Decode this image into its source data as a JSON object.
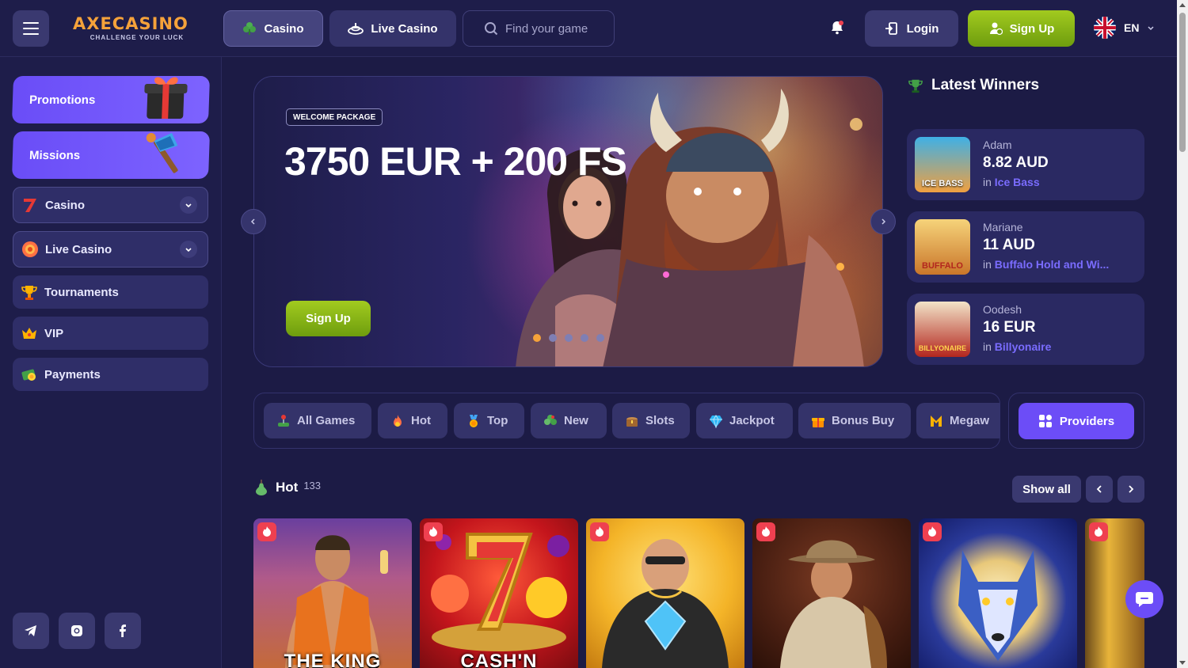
{
  "header": {
    "logo_text": "AXECASINO",
    "logo_tagline": "CHALLENGE YOUR LUCK",
    "nav_casino": "Casino",
    "nav_live_casino": "Live Casino",
    "search_placeholder": "Find your game",
    "login_label": "Login",
    "signup_label": "Sign Up",
    "language": "EN"
  },
  "sidebar": {
    "promo_cards": [
      "Promotions",
      "Missions"
    ],
    "items": [
      {
        "label": "Casino",
        "icon": "seven-icon",
        "expandable": true
      },
      {
        "label": "Live Casino",
        "icon": "chip-icon",
        "expandable": true
      },
      {
        "label": "Tournaments",
        "icon": "trophy-icon",
        "expandable": false
      },
      {
        "label": "VIP",
        "icon": "crown-icon",
        "expandable": false
      },
      {
        "label": "Payments",
        "icon": "money-icon",
        "expandable": false
      }
    ],
    "social": [
      "telegram-icon",
      "instagram-icon",
      "facebook-icon"
    ]
  },
  "banner": {
    "badge": "WELCOME PACKAGE",
    "headline": "3750 EUR + 200 FS",
    "button": "Sign Up",
    "slides": 5,
    "active_slide": 1
  },
  "winners": {
    "title": "Latest Winners",
    "in_word": "in",
    "list": [
      {
        "name": "Adam",
        "amount": "8.82 AUD",
        "game": "Ice Bass",
        "thumb_text": "ICE BASS"
      },
      {
        "name": "Mariane",
        "amount": "11 AUD",
        "game": "Buffalo Hold and Wi...",
        "thumb_text": "BUFFALO"
      },
      {
        "name": "Oodesh",
        "amount": "16 EUR",
        "game": "Billyonaire",
        "thumb_text": "BILLYONAIRE"
      }
    ]
  },
  "categories": {
    "items": [
      "All Games",
      "Hot",
      "Top",
      "New",
      "Slots",
      "Jackpot",
      "Bonus Buy",
      "Megaw"
    ],
    "providers_label": "Providers"
  },
  "hot_section": {
    "title": "Hot",
    "count": "133",
    "show_all": "Show all",
    "games": [
      {
        "title": "THE KING"
      },
      {
        "title": "CASH'N"
      },
      {
        "title": ""
      },
      {
        "title": ""
      },
      {
        "title": ""
      },
      {
        "title": ""
      }
    ]
  },
  "colors": {
    "background": "#1c1b45",
    "accent_purple": "#6c4df7",
    "accent_green": "#8cbc18",
    "accent_orange": "#f5a23a",
    "hot_tag": "#ef4050"
  }
}
